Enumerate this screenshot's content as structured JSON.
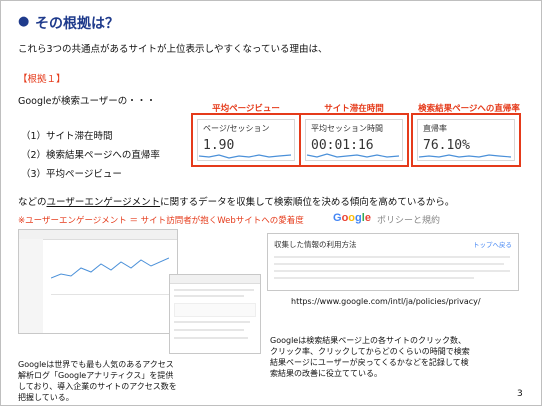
{
  "slide": {
    "title": "その根拠は？",
    "intro": "これら3つの共通点があるサイトが上位表示しやすくなっている理由は、",
    "rootno": "【根拠１】",
    "google_line": "Googleが検索ユーザーの・・・",
    "items": [
      "（1）サイト滞在時間",
      "（2）検索結果ページへの直帰率",
      "（3）平均ページビュー"
    ],
    "engagement_prefix": "などの",
    "engagement_term": "ユーザーエンゲージメント",
    "engagement_suffix": "に関するデータを収集して検索順位を決める傾向を高めているから。",
    "note": "※ユーザーエンゲージメント ＝ サイト訪問者が抱くWebサイトへの愛着度",
    "page_number": "3"
  },
  "metric_cards": [
    {
      "label": "平均ページビュー",
      "title": "ページ/セッション",
      "value": "1.90"
    },
    {
      "label": "サイト滞在時間",
      "title": "平均セッション時間",
      "value": "00:01:16"
    },
    {
      "label": "検索結果ページへの直帰率",
      "title": "直帰率",
      "value": "76.10%"
    }
  ],
  "google_policy": {
    "logo": "Google",
    "text": "ポリシーと規約",
    "heading": "収集した情報の利用方法",
    "link": "トップへ戻る",
    "url": "https://www.google.com/intl/ja/policies/privacy/"
  },
  "captions": {
    "analytics": "Googleは世界でも最も人気のあるアクセス解析ログ「Googleアナリティクス」を提供しており、導入企業のサイトのアクセス数を把握している。",
    "search_console": "Googleは検索結果ページ上の各サイトのクリック数、クリック率、クリックしてからどのくらいの時間で検索結果ページにユーザーが戻ってくるかなどを記録して検索結果の改善に役立てている。"
  },
  "colors": {
    "title": "#1f3b8c",
    "accent": "#e53a1a",
    "chart_line": "#4a90d9"
  }
}
